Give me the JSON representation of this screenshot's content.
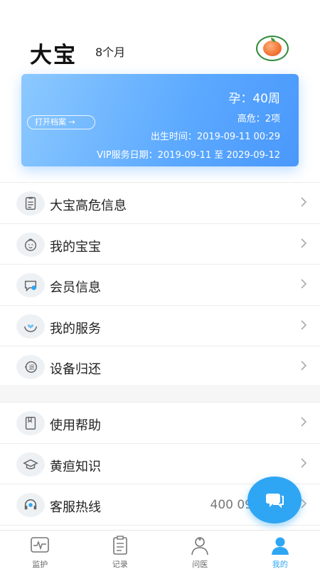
{
  "profile": {
    "name": "大宝",
    "age": "8个月"
  },
  "card": {
    "pregnancy": "孕：40周",
    "high_risk": "高危：2项",
    "birth_time": "出生时间：2019-09-11 00:29",
    "vip_period": "VIP服务日期：2019-09-11 至 2029-09-12",
    "open_record": "打开档案 →"
  },
  "menu_group1": [
    {
      "label": "大宝高危信息",
      "icon": "clipboard-icon"
    },
    {
      "label": "我的宝宝",
      "icon": "baby-face-icon"
    },
    {
      "label": "会员信息",
      "icon": "chat-bubble-icon"
    },
    {
      "label": "我的服务",
      "icon": "hands-heart-icon"
    },
    {
      "label": "设备归还",
      "icon": "return-icon"
    }
  ],
  "menu_group2": [
    {
      "label": "使用帮助",
      "icon": "book-icon"
    },
    {
      "label": "黄疸知识",
      "icon": "graduation-cap-icon"
    },
    {
      "label": "客服热线",
      "icon": "headset-icon",
      "value": "400 09"
    }
  ],
  "tabs": [
    {
      "label": "监护",
      "icon": "monitor-icon",
      "active": false
    },
    {
      "label": "记录",
      "icon": "record-icon",
      "active": false
    },
    {
      "label": "问医",
      "icon": "doctor-icon",
      "active": false
    },
    {
      "label": "我的",
      "icon": "user-icon",
      "active": true
    }
  ],
  "colors": {
    "accent": "#2fa6f3",
    "card_start": "#8cc9ff",
    "card_end": "#4a98fb",
    "avatar_ring": "#2e8b3a"
  }
}
